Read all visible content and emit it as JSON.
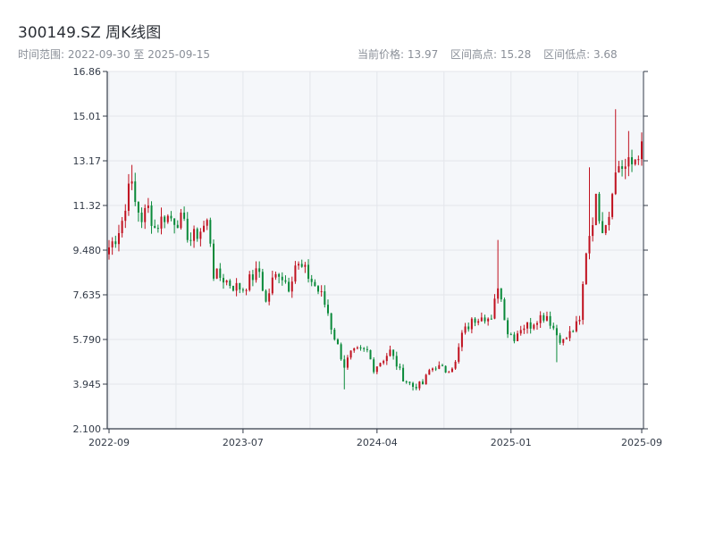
{
  "header": {
    "title": "300149.SZ 周K线图",
    "range_text": "时间范围: 2022-09-30 至 2025-09-15",
    "current_price": "当前价格: 13.97",
    "range_high": "区间高点: 15.28",
    "range_low": "区间低点: 3.68"
  },
  "chart_data": {
    "type": "candlestick",
    "title": "300149.SZ 周K线图",
    "xlabel": "",
    "ylabel": "",
    "ylim": [
      2.1,
      16.86
    ],
    "y_ticks": [
      "2.100",
      "3.945",
      "5.790",
      "7.635",
      "9.480",
      "11.32",
      "13.17",
      "15.01",
      "16.86"
    ],
    "x_ticks": [
      "2022-09",
      "2023-07",
      "2024-04",
      "2025-01",
      "2025-09"
    ],
    "x_tick_weeks": [
      0,
      41,
      82,
      123,
      163
    ],
    "grid": true,
    "up_color": "#c0111f",
    "down_color": "#0a8a3a",
    "num_weeks": 163,
    "anchors": [
      [
        0,
        9.6
      ],
      [
        2,
        10.0
      ],
      [
        5,
        11.1
      ],
      [
        6,
        12.6
      ],
      [
        8,
        11.4
      ],
      [
        10,
        10.8
      ],
      [
        12,
        11.2
      ],
      [
        14,
        10.4
      ],
      [
        17,
        10.9
      ],
      [
        19,
        10.8
      ],
      [
        22,
        10.7
      ],
      [
        25,
        9.9
      ],
      [
        28,
        10.3
      ],
      [
        30,
        10.6
      ],
      [
        31,
        9.9
      ],
      [
        32,
        8.5
      ],
      [
        35,
        8.3
      ],
      [
        38,
        8.0
      ],
      [
        41,
        7.9
      ],
      [
        44,
        8.4
      ],
      [
        46,
        8.6
      ],
      [
        48,
        7.3
      ],
      [
        50,
        8.2
      ],
      [
        52,
        8.6
      ],
      [
        55,
        8.0
      ],
      [
        57,
        8.9
      ],
      [
        60,
        8.6
      ],
      [
        62,
        8.2
      ],
      [
        65,
        7.6
      ],
      [
        67,
        6.9
      ],
      [
        68,
        6.3
      ],
      [
        72,
        4.7
      ],
      [
        74,
        5.2
      ],
      [
        76,
        5.3
      ],
      [
        79,
        5.3
      ],
      [
        81,
        4.6
      ],
      [
        84,
        5.0
      ],
      [
        86,
        5.3
      ],
      [
        90,
        4.2
      ],
      [
        93,
        3.85
      ],
      [
        96,
        3.95
      ],
      [
        98,
        4.5
      ],
      [
        100,
        4.7
      ],
      [
        103,
        4.5
      ],
      [
        106,
        4.8
      ],
      [
        108,
        6.0
      ],
      [
        111,
        6.5
      ],
      [
        114,
        6.9
      ],
      [
        117,
        6.5
      ],
      [
        119,
        8.1
      ],
      [
        121,
        6.8
      ],
      [
        122,
        6.1
      ],
      [
        124,
        5.9
      ],
      [
        126,
        6.3
      ],
      [
        129,
        6.4
      ],
      [
        131,
        6.7
      ],
      [
        134,
        6.8
      ],
      [
        137,
        6.0
      ],
      [
        139,
        5.7
      ],
      [
        142,
        6.2
      ],
      [
        144,
        6.5
      ],
      [
        146,
        9.5
      ],
      [
        149,
        11.5
      ],
      [
        151,
        10.5
      ],
      [
        153,
        11.0
      ],
      [
        154,
        12.2
      ],
      [
        156,
        13.0
      ],
      [
        158,
        12.9
      ],
      [
        160,
        13.0
      ],
      [
        162,
        13.6
      ],
      [
        163,
        13.97
      ]
    ],
    "spikes": [
      [
        7,
        13.0
      ],
      [
        119,
        9.9
      ],
      [
        147,
        12.9
      ],
      [
        155,
        15.3
      ],
      [
        159,
        14.4
      ]
    ],
    "dips": [
      [
        72,
        3.73
      ],
      [
        93,
        3.68
      ],
      [
        137,
        4.85
      ]
    ]
  }
}
